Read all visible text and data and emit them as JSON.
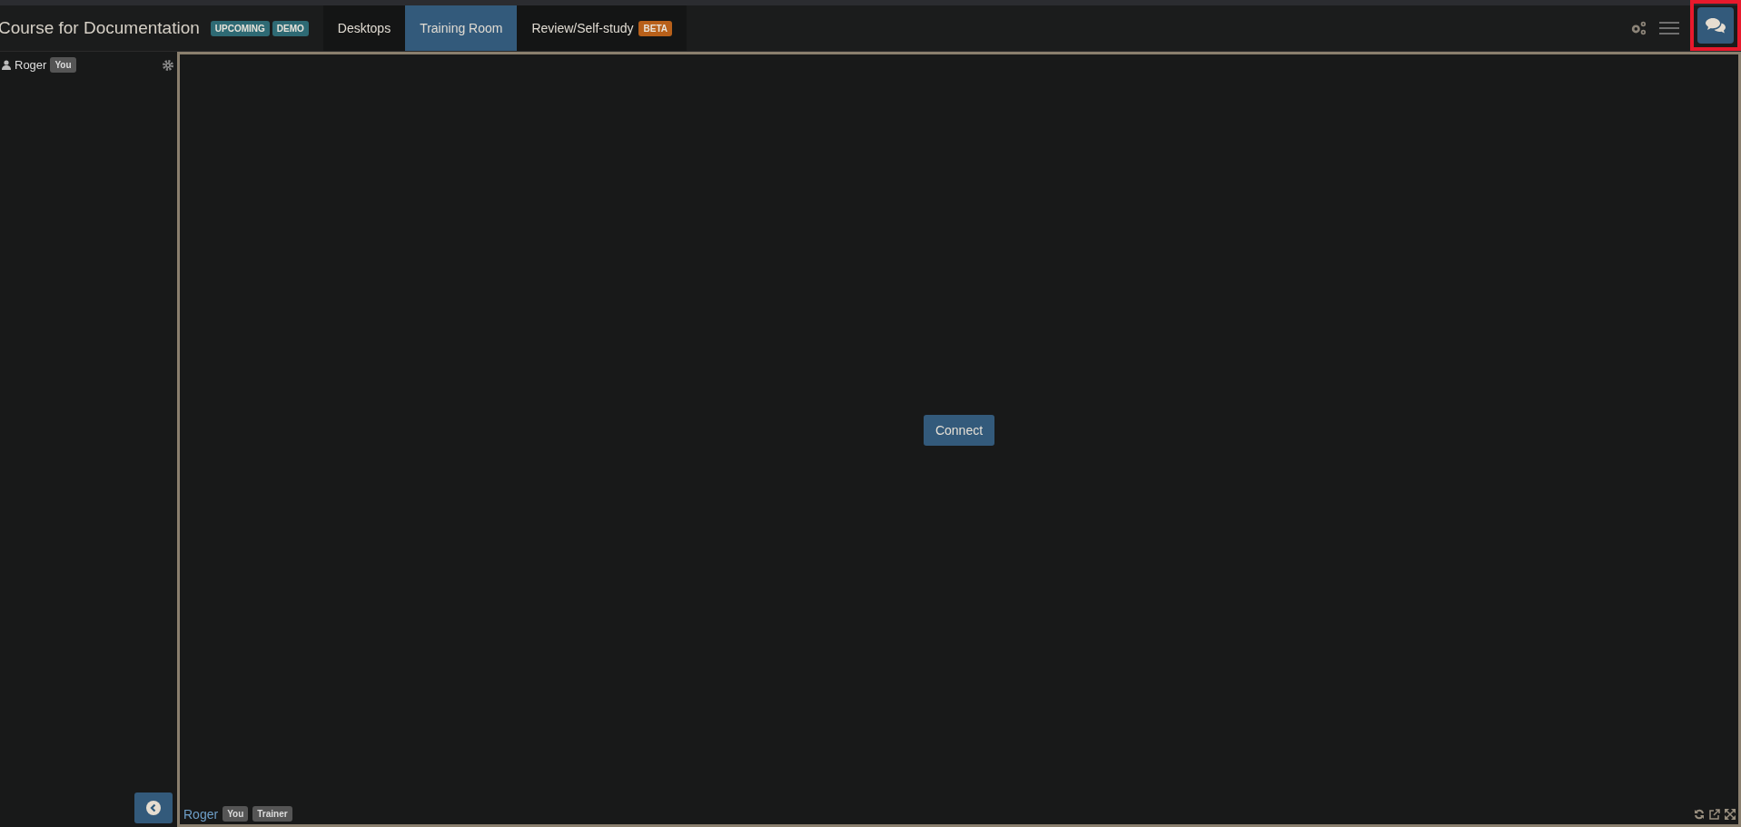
{
  "header": {
    "title": "Course for Documentation",
    "badges": [
      {
        "label": "UPCOMING"
      },
      {
        "label": "DEMO"
      }
    ],
    "tabs": [
      {
        "label": "Desktops",
        "selected": false
      },
      {
        "label": "Training Room",
        "selected": true
      },
      {
        "label": "Review/Self-study",
        "selected": false,
        "badge": "BETA"
      }
    ]
  },
  "sidebar": {
    "participants": [
      {
        "name": "Roger",
        "tag": "You"
      }
    ]
  },
  "main": {
    "connect_button": "Connect",
    "presenter": {
      "name": "Roger",
      "tags": [
        "You",
        "Trainer"
      ]
    }
  }
}
